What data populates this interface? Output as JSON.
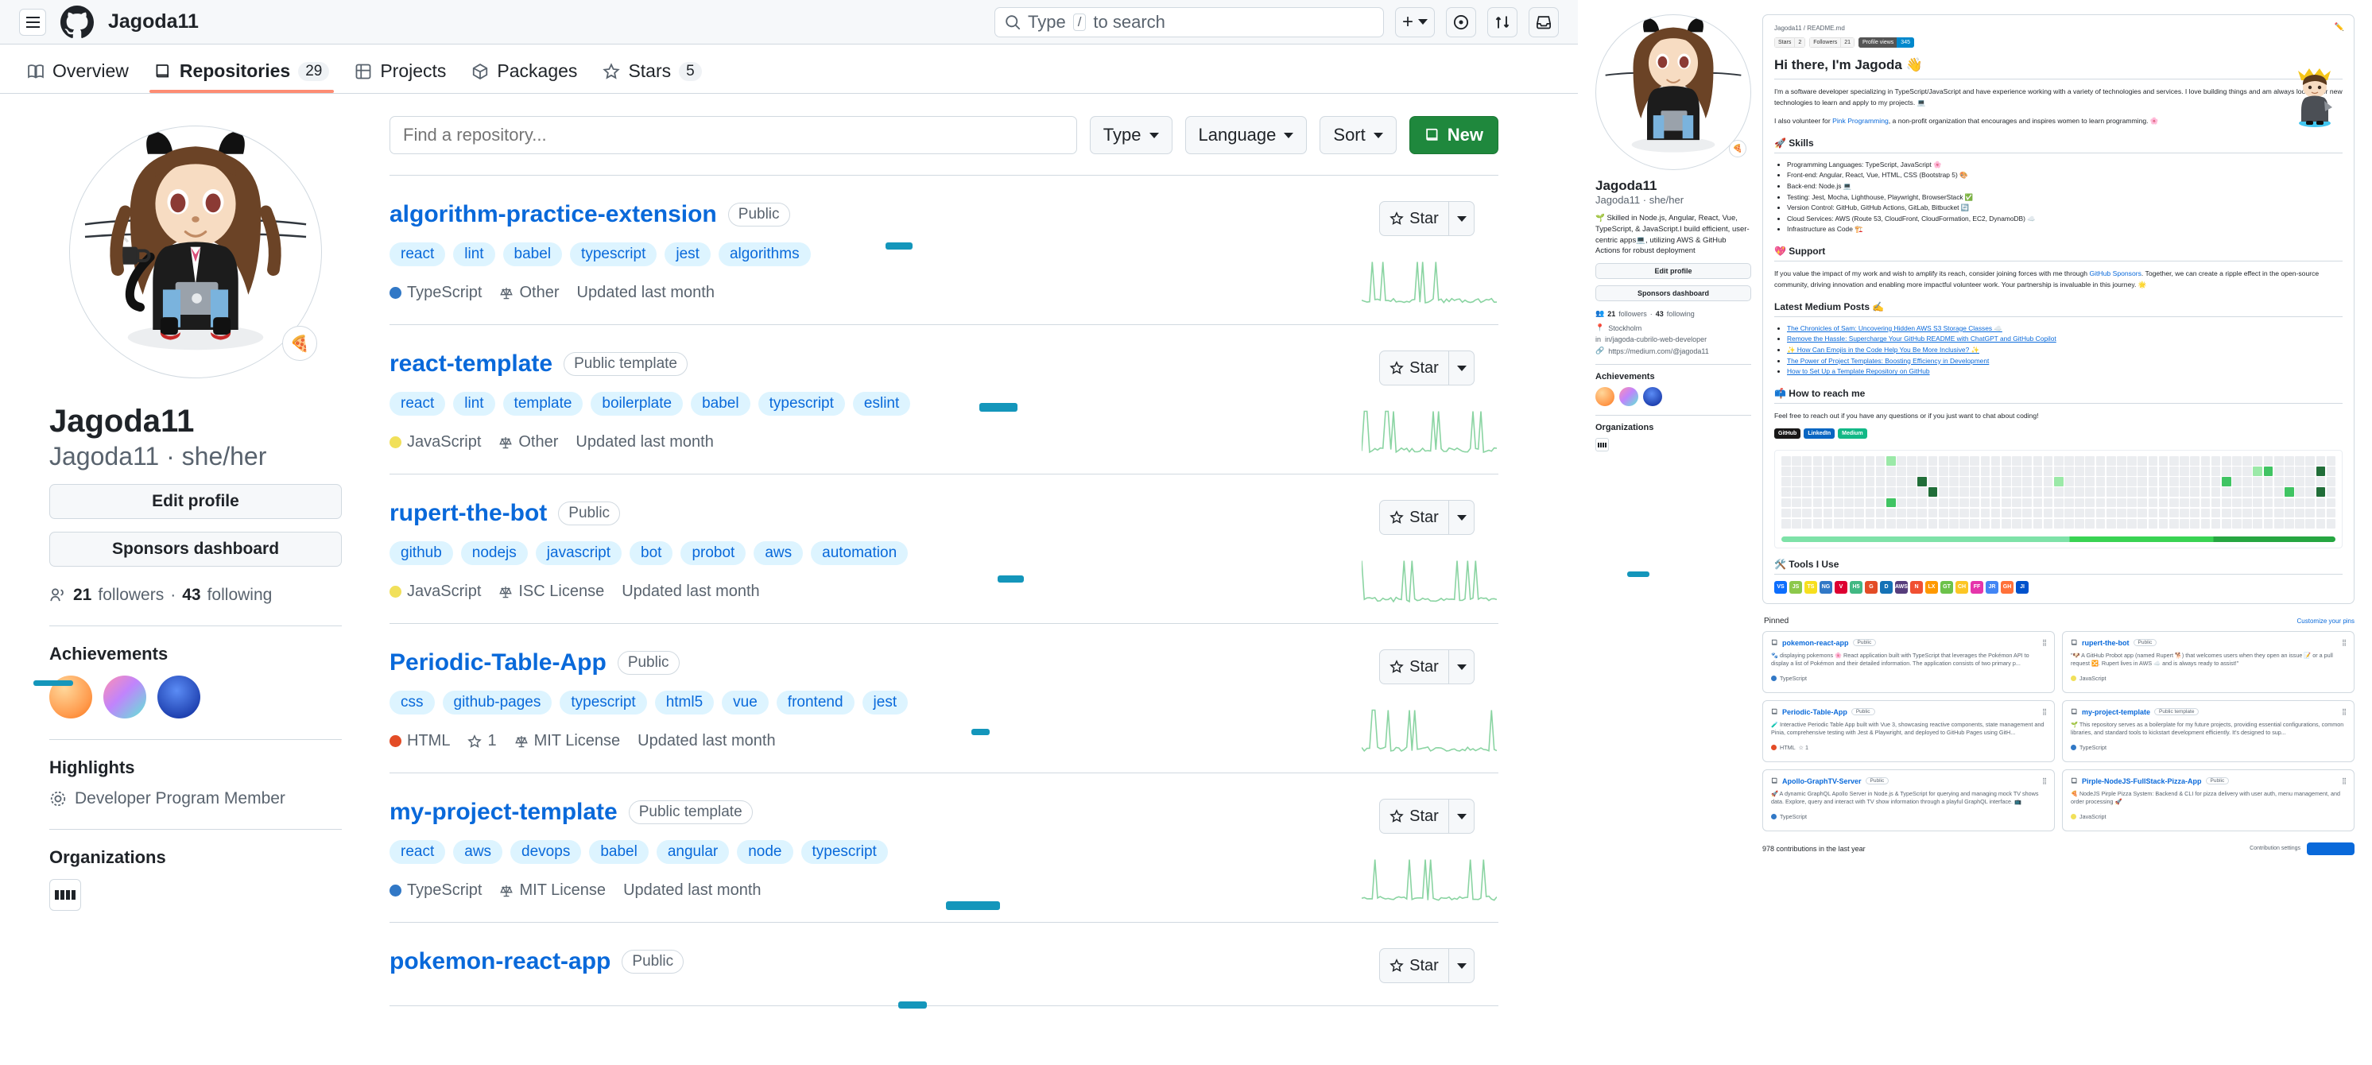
{
  "browser": {
    "header": {
      "owner": "Jagoda11",
      "search_placeholder": "Type / to search",
      "search_kbd": "/",
      "menu_icon": "hamburger-icon",
      "logo_icon": "github-logo-icon",
      "icons": [
        "plus-icon",
        "chevron-down-icon",
        "issues-icon",
        "pull-requests-icon",
        "inbox-icon"
      ]
    },
    "nav": [
      {
        "label": "Overview",
        "icon": "book-icon",
        "count": null,
        "active": false
      },
      {
        "label": "Repositories",
        "icon": "repo-icon",
        "count": "29",
        "active": true
      },
      {
        "label": "Projects",
        "icon": "project-icon",
        "count": null,
        "active": false
      },
      {
        "label": "Packages",
        "icon": "package-icon",
        "count": null,
        "active": false
      },
      {
        "label": "Stars",
        "icon": "star-icon",
        "count": "5",
        "active": false
      }
    ]
  },
  "profile": {
    "avatar_alt": "octocat-avatar",
    "status_emoji": "🍕",
    "name": "Jagoda11",
    "handle_line": "Jagoda11 · she/her",
    "edit_profile_label": "Edit profile",
    "sponsors_label": "Sponsors dashboard",
    "followers_count": "21",
    "followers_label": "followers",
    "following_count": "43",
    "following_label": "following",
    "achievements_title": "Achievements",
    "achievements": [
      "quickdraw-badge",
      "yolo-badge",
      "pull-shark-badge"
    ],
    "highlights_title": "Highlights",
    "highlights": [
      "Developer Program Member"
    ],
    "organizations_title": "Organizations",
    "organizations": [
      "org-avatar"
    ]
  },
  "repo_filter": {
    "find_placeholder": "Find a repository...",
    "type_label": "Type",
    "language_label": "Language",
    "sort_label": "Sort",
    "new_label": "New",
    "new_icon": "repo-icon"
  },
  "repositories": [
    {
      "name": "algorithm-practice-extension",
      "visibility": "Public",
      "topics": [
        "react",
        "lint",
        "babel",
        "typescript",
        "jest",
        "algorithms"
      ],
      "language": "TypeScript",
      "language_color": "#3178c6",
      "license": "Other",
      "stars": null,
      "updated": "Updated last month",
      "star_label": "Star"
    },
    {
      "name": "react-template",
      "visibility": "Public template",
      "topics": [
        "react",
        "lint",
        "template",
        "boilerplate",
        "babel",
        "typescript",
        "eslint"
      ],
      "language": "JavaScript",
      "language_color": "#f1e05a",
      "license": "Other",
      "stars": null,
      "updated": "Updated last month",
      "star_label": "Star"
    },
    {
      "name": "rupert-the-bot",
      "visibility": "Public",
      "topics": [
        "github",
        "nodejs",
        "javascript",
        "bot",
        "probot",
        "aws",
        "automation"
      ],
      "language": "JavaScript",
      "language_color": "#f1e05a",
      "license": "ISC License",
      "stars": null,
      "updated": "Updated last month",
      "star_label": "Star"
    },
    {
      "name": "Periodic-Table-App",
      "visibility": "Public",
      "topics": [
        "css",
        "github-pages",
        "typescript",
        "html5",
        "vue",
        "frontend",
        "jest"
      ],
      "language": "HTML",
      "language_color": "#e34c26",
      "license": "MIT License",
      "stars": "1",
      "updated": "Updated last month",
      "star_label": "Star"
    },
    {
      "name": "my-project-template",
      "visibility": "Public template",
      "topics": [
        "react",
        "aws",
        "devops",
        "babel",
        "angular",
        "node",
        "typescript"
      ],
      "language": "TypeScript",
      "language_color": "#3178c6",
      "license": "MIT License",
      "stars": null,
      "updated": "Updated last month",
      "star_label": "Star"
    },
    {
      "name": "pokemon-react-app",
      "visibility": "Public",
      "topics": [],
      "language": null,
      "language_color": "#3178c6",
      "license": null,
      "stars": null,
      "updated": null,
      "star_label": "Star"
    }
  ],
  "readme_panel": {
    "profile": {
      "name": "Jagoda11",
      "handle_line": "Jagoda11 · she/her",
      "bio": "🌱 Skilled in Node.js, Angular, React, Vue, TypeScript, & JavaScript.I build efficient, user-centric apps💻, utilizing AWS & GitHub Actions for robust deployment",
      "edit_profile_label": "Edit profile",
      "sponsors_label": "Sponsors dashboard",
      "followers_count": "21",
      "followers_label": "followers",
      "following_count": "43",
      "following_label": "following",
      "location": "Stockholm",
      "linkedin": "in/jagoda-cubrilo-web-developer",
      "website": "https://medium.com/@jagoda11",
      "achievements_title": "Achievements",
      "organizations_title": "Organizations"
    },
    "card": {
      "breadcrumb": "Jagoda11 / README.md",
      "edit_icon": "pencil-icon",
      "shields": [
        {
          "key": "Stars",
          "value": "2",
          "dark": false
        },
        {
          "key": "Followers",
          "value": "21",
          "dark": false
        },
        {
          "key": "Profile views",
          "value": "345",
          "dark": true
        }
      ],
      "heading": "Hi there, I'm Jagoda 👋",
      "intro_1": "I'm a software developer specializing in TypeScript/JavaScript and have experience working with a variety of technologies and services. I love building things and am always looking for new technologies to learn and apply to my projects. 💻",
      "intro_2_pre": "I also volunteer for ",
      "intro_2_link": "Pink Programming",
      "intro_2_post": ", a non-profit organization that encourages and inspires women to learn programming. 🌸",
      "skills_title": "🚀 Skills",
      "skills": [
        "Programming Languages: TypeScript, JavaScript 🌸",
        "Front-end: Angular, React, Vue, HTML, CSS (Bootstrap 5) 🎨",
        "Back-end: Node.js 💻",
        "Testing: Jest, Mocha, Lighthouse, Playwright, BrowserStack ✅",
        "Version Control: GitHub, GitHub Actions, GitLab, Bitbucket 🔄",
        "Cloud Services: AWS (Route 53, CloudFront, CloudFormation, EC2, DynamoDB) ☁️",
        "Infrastructure as Code 🏗️"
      ],
      "support_title": "💖 Support",
      "support_pre": "If you value the impact of my work and wish to amplify its reach, consider joining forces with me through ",
      "support_link": "GitHub Sponsors",
      "support_post": ". Together, we can create a ripple effect in the open-source community, driving innovation and enabling more impactful volunteer work. Your partnership is invaluable in this journey. 🌟",
      "medium_title": "Latest Medium Posts ✍️",
      "medium_posts": [
        "The Chronicles of Sam: Uncovering Hidden AWS S3 Storage Classes ☁️",
        "Remove the Hassle: Supercharge Your GitHub README with ChatGPT and GitHub Copilot",
        "✨ How Can Emojis in the Code Help You Be More Inclusive? ✨",
        "The Power of Project Templates: Boosting Efficiency in Development",
        "How to Set Up a Template Repository on GitHub"
      ],
      "reach_title": "📫 How to reach me",
      "reach_text": "Feel free to reach out if you have any questions or if you just want to chat about coding!",
      "socials": [
        {
          "label": "GitHub",
          "color": "#181717"
        },
        {
          "label": "LinkedIn",
          "color": "#0a66c2"
        },
        {
          "label": "Medium",
          "color": "#12b886"
        }
      ],
      "tools_title": "🛠️ Tools I Use",
      "tools": [
        "VS",
        "JS",
        "TS",
        "NG",
        "V",
        "H5",
        "G",
        "D",
        "AWS",
        "N",
        "LX",
        "GT",
        "CH",
        "FF",
        "JR",
        "GH",
        "JI"
      ]
    },
    "pinned": {
      "title": "Pinned",
      "customize_label": "Customize your pins",
      "items": [
        {
          "name": "pokemon-react-app",
          "visibility": "Public",
          "description": "🐾 displaying pokemons 🌸 React application built with TypeScript that leverages the Pokémon API to display a list of Pokémon and their detailed information. The application consists of two primary p...",
          "language": "TypeScript",
          "language_color": "#3178c6"
        },
        {
          "name": "rupert-the-bot",
          "visibility": "Public",
          "description": "\"🐶 A GitHub Probot app (named Rupert 🐕) that welcomes users when they open an issue 📝 or a pull request 🔀. Rupert lives in AWS ☁️ and is always ready to assist!\"",
          "language": "JavaScript",
          "language_color": "#f1e05a"
        },
        {
          "name": "Periodic-Table-App",
          "visibility": "Public",
          "description": "🧪 Interactive Periodic Table App built with Vue 3, showcasing reactive components, state management and Pinia, comprehensive testing with Jest & Playwright, and deployed to GitHub Pages using GitH...",
          "language": "HTML",
          "language_color": "#e34c26",
          "stars": "1"
        },
        {
          "name": "my-project-template",
          "visibility": "Public template",
          "description": "🌱 This repository serves as a boilerplate for my future projects, providing essential configurations, common libraries, and standard tools to kickstart development efficiently. It's designed to sup...",
          "language": "TypeScript",
          "language_color": "#3178c6"
        },
        {
          "name": "Apollo-GraphTV-Server",
          "visibility": "Public",
          "description": "🚀 A dynamic GraphQL Apollo Server in Node.js & TypeScript for querying and managing mock TV shows data. Explore, query and interact with TV show information through a playful GraphQL interface. 📺",
          "language": "TypeScript",
          "language_color": "#3178c6"
        },
        {
          "name": "Pirple-NodeJS-FullStack-Pizza-App",
          "visibility": "Public",
          "description": "🍕 NodeJS Pirple Pizza System: Backend & CLI for pizza delivery with user auth, menu management, and order processing 🚀",
          "language": "JavaScript",
          "language_color": "#f1e05a"
        }
      ]
    },
    "contributions": {
      "text": "978 contributions in the last year",
      "selector_label": "Contribution settings"
    }
  }
}
